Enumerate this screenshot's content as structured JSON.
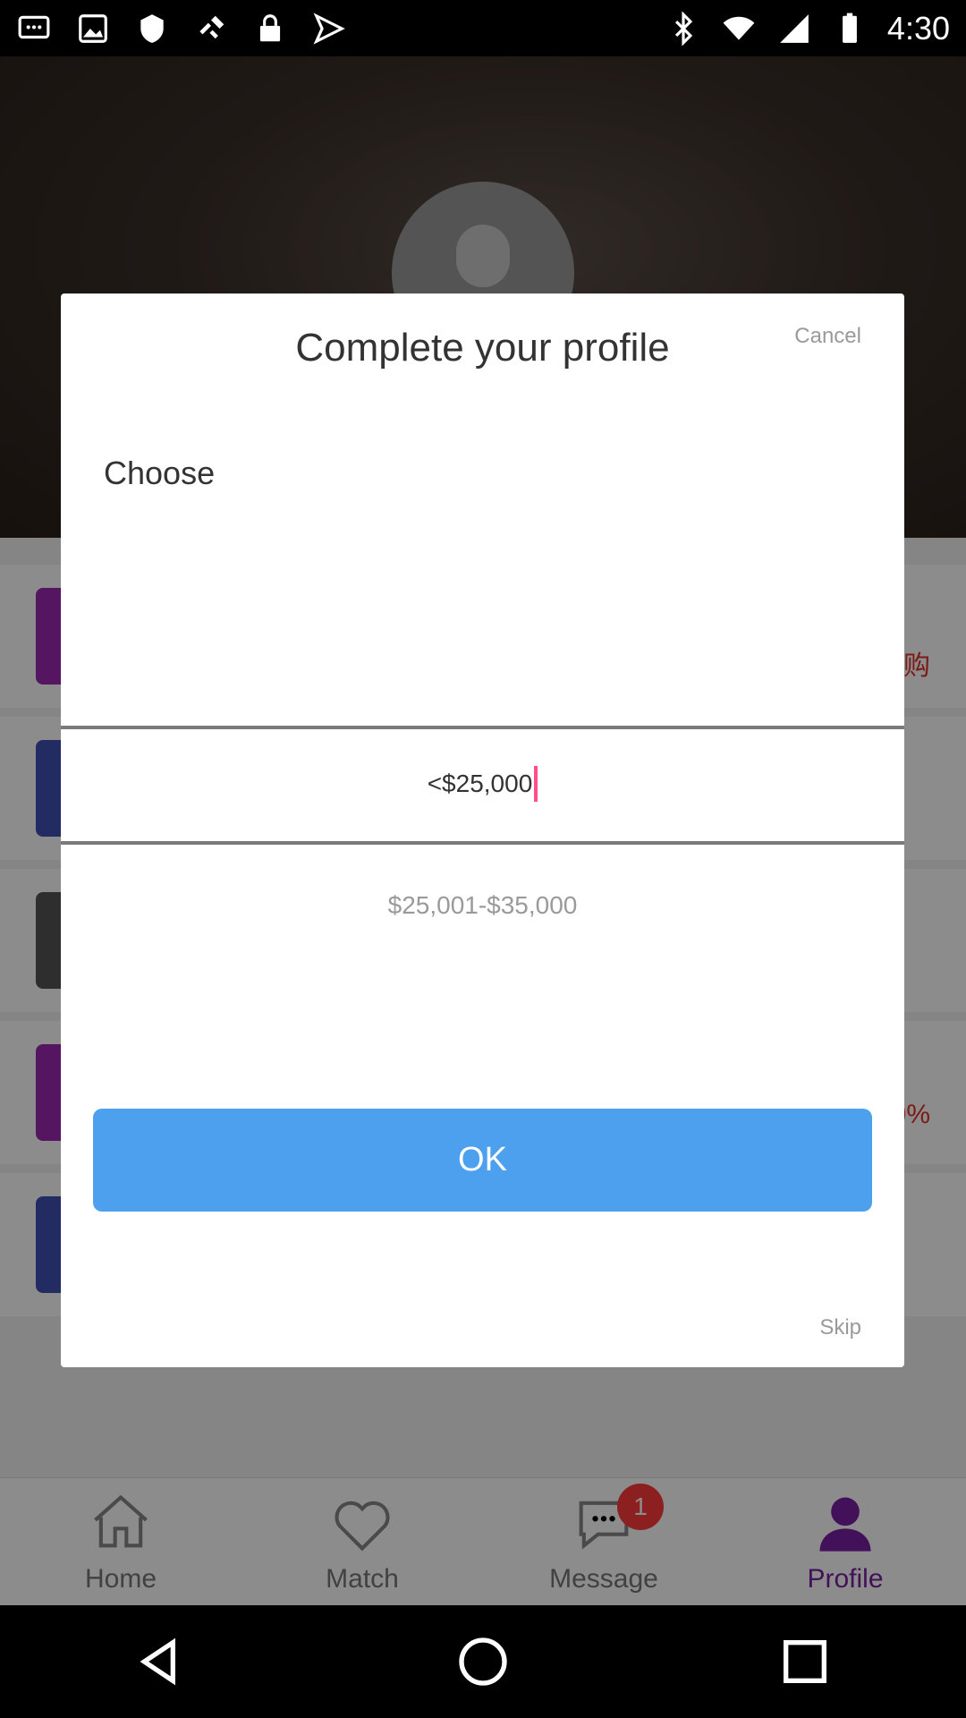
{
  "status_bar": {
    "time": "4:30",
    "left_icons": [
      "messages-icon",
      "photo-icon",
      "shield-icon",
      "fake-gps-icon",
      "lock-icon",
      "send-icon"
    ],
    "right_icons": [
      "bluetooth-icon",
      "wifi-icon",
      "signal-icon",
      "battery-icon"
    ]
  },
  "background": {
    "list_snippets": [
      "购",
      "0%"
    ]
  },
  "tabbar": {
    "tabs": [
      {
        "label": "Home",
        "icon": "home-icon"
      },
      {
        "label": "Match",
        "icon": "heart-icon"
      },
      {
        "label": "Message",
        "icon": "chat-icon",
        "badge": "1"
      },
      {
        "label": "Profile",
        "icon": "person-icon"
      }
    ],
    "active_color": "#7b1fa2"
  },
  "dialog": {
    "title": "Complete your profile",
    "cancel_label": "Cancel",
    "section_label": "Choose",
    "picker": {
      "selected": "<$25,000",
      "next": "$25,001-$35,000"
    },
    "ok_label": "OK",
    "skip_label": "Skip",
    "ok_color": "#4da0ee"
  }
}
